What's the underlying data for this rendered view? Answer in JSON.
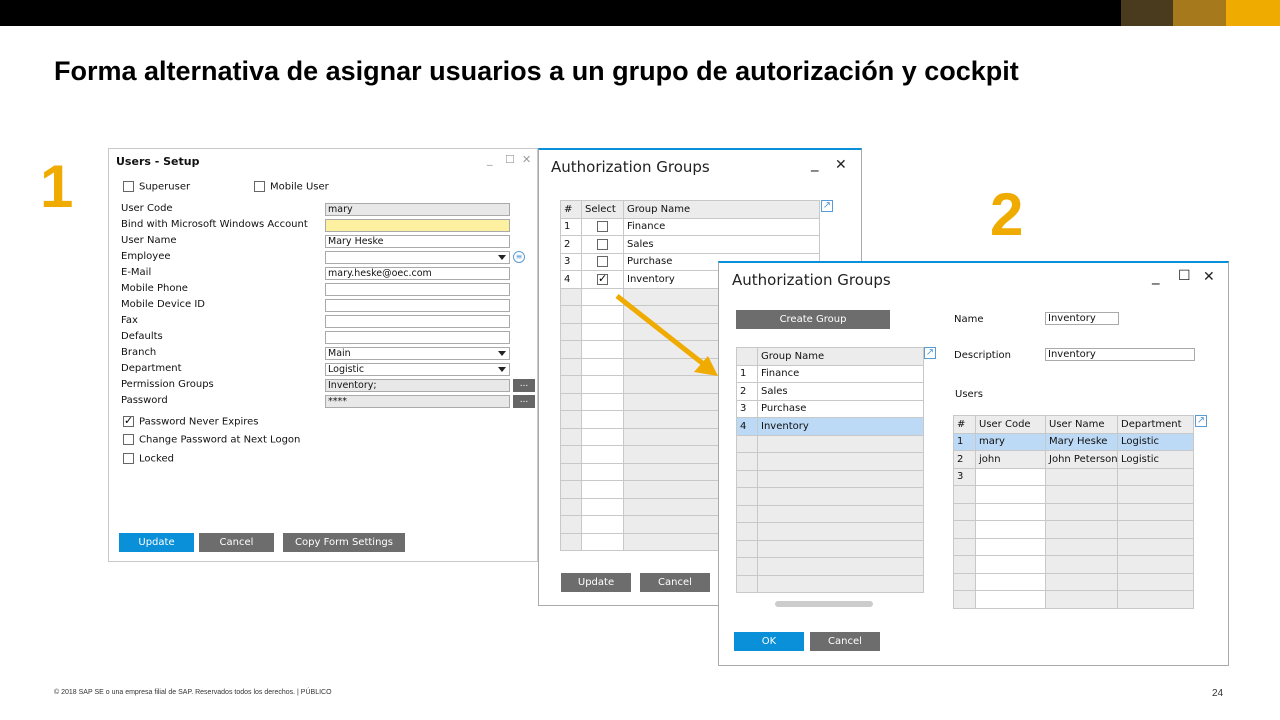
{
  "slide": {
    "title": "Forma alternativa de asignar usuarios a un grupo de autorización y cockpit",
    "step1": "1",
    "step2": "2",
    "footer": "© 2018 SAP SE o una empresa filial de SAP. Reservados todos los derechos.   |   PÚBLICO",
    "page_number": "24",
    "colors": {
      "accent": "#f0ab00",
      "button_blue": "#0a8fd9",
      "selection": "#bcd9f5"
    }
  },
  "users_setup": {
    "title": "Users - Setup",
    "superuser_label": "Superuser",
    "mobile_user_label": "Mobile User",
    "fields": {
      "user_code_label": "User Code",
      "user_code": "mary",
      "bind_label": "Bind with Microsoft Windows Account",
      "bind": "",
      "user_name_label": "User Name",
      "user_name": "Mary Heske",
      "employee_label": "Employee",
      "employee": "",
      "email_label": "E-Mail",
      "email": "mary.heske@oec.com",
      "mobile_phone_label": "Mobile Phone",
      "mobile_phone": "",
      "mobile_device_label": "Mobile Device ID",
      "mobile_device": "",
      "fax_label": "Fax",
      "fax": "",
      "defaults_label": "Defaults",
      "defaults": "",
      "branch_label": "Branch",
      "branch": "Main",
      "department_label": "Department",
      "department": "Logistic",
      "permission_label": "Permission Groups",
      "permission": "Inventory;",
      "password_label": "Password",
      "password": "****"
    },
    "dots_button": "...",
    "password_never_expires": "Password Never Expires",
    "change_password": "Change Password at Next Logon",
    "locked": "Locked",
    "buttons": {
      "update": "Update",
      "cancel": "Cancel",
      "copy": "Copy Form Settings"
    }
  },
  "auth_groups_1": {
    "title": "Authorization Groups",
    "columns": [
      "#",
      "Select",
      "Group Name"
    ],
    "rows": [
      {
        "num": "1",
        "selected": false,
        "name": "Finance"
      },
      {
        "num": "2",
        "selected": false,
        "name": "Sales"
      },
      {
        "num": "3",
        "selected": false,
        "name": "Purchase"
      },
      {
        "num": "4",
        "selected": true,
        "name": "Inventory"
      }
    ],
    "buttons": {
      "update": "Update",
      "cancel": "Cancel"
    }
  },
  "auth_groups_2": {
    "title": "Authorization Groups",
    "create_group": "Create Group",
    "group_column": "Group Name",
    "groups": [
      {
        "num": "1",
        "name": "Finance"
      },
      {
        "num": "2",
        "name": "Sales"
      },
      {
        "num": "3",
        "name": "Purchase"
      },
      {
        "num": "4",
        "name": "Inventory"
      }
    ],
    "name_label": "Name",
    "name_value": "Inventory",
    "description_label": "Description",
    "description_value": "Inventory",
    "users_label": "Users",
    "user_columns": [
      "#",
      "User Code",
      "User Name",
      "Department"
    ],
    "users": [
      {
        "num": "1",
        "code": "mary",
        "name": "Mary Heske",
        "dept": "Logistic"
      },
      {
        "num": "2",
        "code": "john",
        "name": "John Peterson",
        "dept": "Logistic"
      },
      {
        "num": "3",
        "code": "",
        "name": "",
        "dept": ""
      }
    ],
    "buttons": {
      "ok": "OK",
      "cancel": "Cancel"
    }
  }
}
